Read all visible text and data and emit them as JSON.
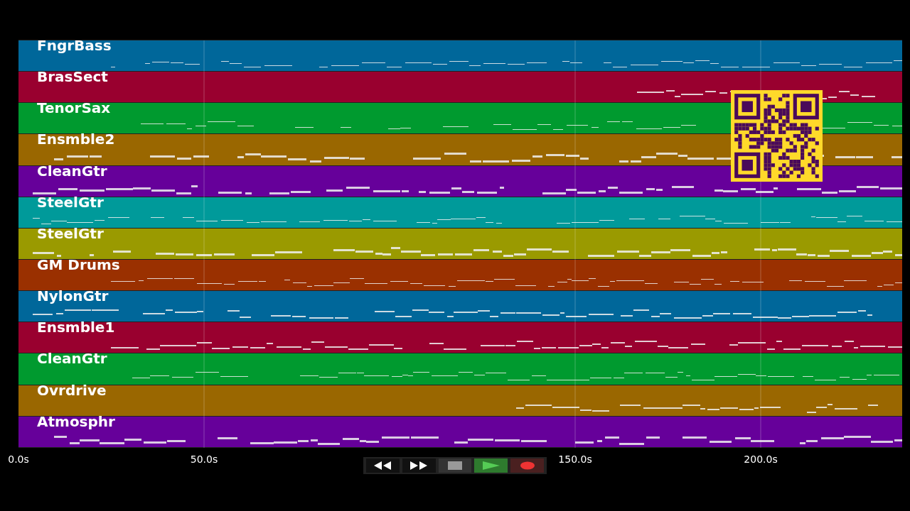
{
  "tracks": [
    {
      "name": "FngrBass",
      "color": "#00679a"
    },
    {
      "name": "BrasSect",
      "color": "#99002f"
    },
    {
      "name": "TenorSax",
      "color": "#009a2f"
    },
    {
      "name": "Ensmble2",
      "color": "#9a6700"
    },
    {
      "name": "CleanGtr",
      "color": "#66009a"
    },
    {
      "name": "SteelGtr",
      "color": "#009a9a"
    },
    {
      "name": "SteelGtr",
      "color": "#9a9a00"
    },
    {
      "name": "GM Drums",
      "color": "#9a3000"
    },
    {
      "name": "NylonGtr",
      "color": "#00679a"
    },
    {
      "name": "Ensmble1",
      "color": "#99002f"
    },
    {
      "name": "CleanGtr",
      "color": "#009a2f"
    },
    {
      "name": "Ovrdrive",
      "color": "#9a6700"
    },
    {
      "name": "Atmosphr",
      "color": "#66009a"
    }
  ],
  "axis": {
    "ticks": [
      {
        "label": "0.0s"
      },
      {
        "label": "50.0s"
      },
      {
        "label": "150.0s"
      },
      {
        "label": "200.0s"
      }
    ]
  },
  "transport": [
    {
      "kind": "rewind",
      "selected": false
    },
    {
      "kind": "forward",
      "selected": false
    },
    {
      "kind": "stop",
      "selected": false
    },
    {
      "kind": "play",
      "selected": true
    },
    {
      "kind": "record",
      "selected": false
    }
  ]
}
